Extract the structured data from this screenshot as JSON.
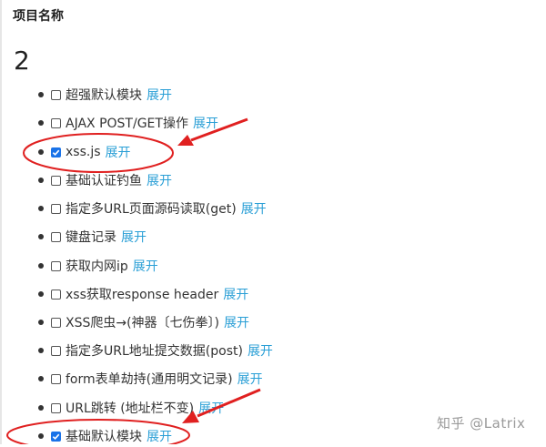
{
  "header": {
    "title": "项目名称"
  },
  "project": {
    "number": "2"
  },
  "modules": [
    {
      "label": "超强默认模块",
      "expand_label": "展开",
      "checked": false
    },
    {
      "label": "AJAX POST/GET操作",
      "expand_label": "展开",
      "checked": false
    },
    {
      "label": "xss.js",
      "expand_label": "展开",
      "checked": true
    },
    {
      "label": "基础认证钓鱼",
      "expand_label": "展开",
      "checked": false
    },
    {
      "label": "指定多URL页面源码读取(get)",
      "expand_label": "展开",
      "checked": false
    },
    {
      "label": "键盘记录",
      "expand_label": "展开",
      "checked": false
    },
    {
      "label": "获取内网ip",
      "expand_label": "展开",
      "checked": false
    },
    {
      "label": "xss获取response header",
      "expand_label": "展开",
      "checked": false
    },
    {
      "label": "XSS爬虫→(神器〔七伤拳〕)",
      "expand_label": "展开",
      "checked": false
    },
    {
      "label": "指定多URL地址提交数据(post)",
      "expand_label": "展开",
      "checked": false
    },
    {
      "label": "form表单劫持(通用明文记录)",
      "expand_label": "展开",
      "checked": false
    },
    {
      "label": "URL跳转 (地址栏不变)",
      "expand_label": "展开",
      "checked": false
    },
    {
      "label": "基础默认模块",
      "expand_label": "展开",
      "checked": true
    }
  ],
  "annotation": {
    "color": "#e02020"
  },
  "watermark": {
    "text": "知乎 @Latrix"
  },
  "colors": {
    "link": "#2a9fd6",
    "checkbox_checked": "#1a73e8"
  }
}
